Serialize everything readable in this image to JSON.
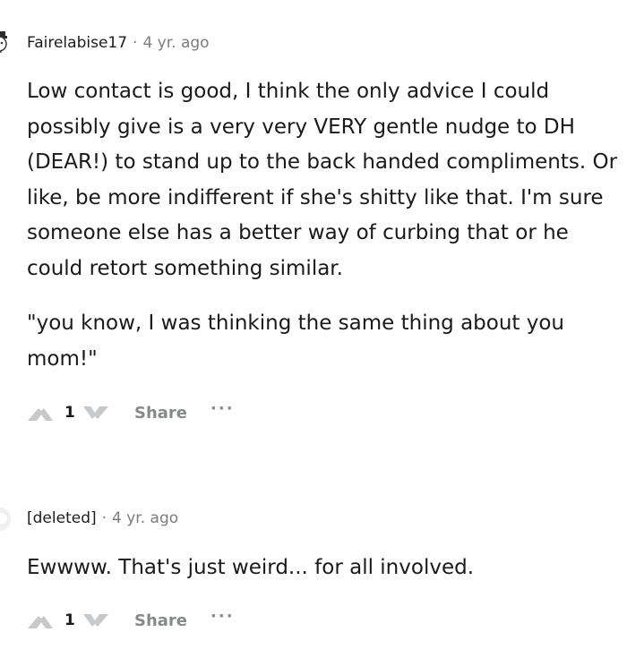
{
  "comments": [
    {
      "author": "Fairelabise17",
      "separator": "·",
      "time": "4 yr. ago",
      "paragraphs": [
        "Low contact is good, I think the only advice I could possibly give is a very very VERY gentle nudge to DH (DEAR!) to stand up to the back handed compliments. Or like, be more indifferent if she's shitty like that. I'm sure someone else has a better way of curbing that or he could retort something similar.",
        "\"you know, I was thinking the same thing about you mom!\""
      ],
      "score": "1",
      "share_label": "Share",
      "more_label": "···",
      "upvote_icon": "upvote-arrow-icon",
      "downvote_icon": "downvote-arrow-icon"
    },
    {
      "author": "[deleted]",
      "separator": "·",
      "time": "4 yr. ago",
      "paragraphs": [
        "Ewwww. That's just weird... for all involved."
      ],
      "score": "1",
      "share_label": "Share",
      "more_label": "···",
      "upvote_icon": "upvote-arrow-icon",
      "downvote_icon": "downvote-arrow-icon"
    }
  ],
  "colors": {
    "text": "#1a1a1b",
    "meta": "#7c7c7c",
    "action": "#878a8c",
    "vote_icon": "#c6c8ca"
  }
}
